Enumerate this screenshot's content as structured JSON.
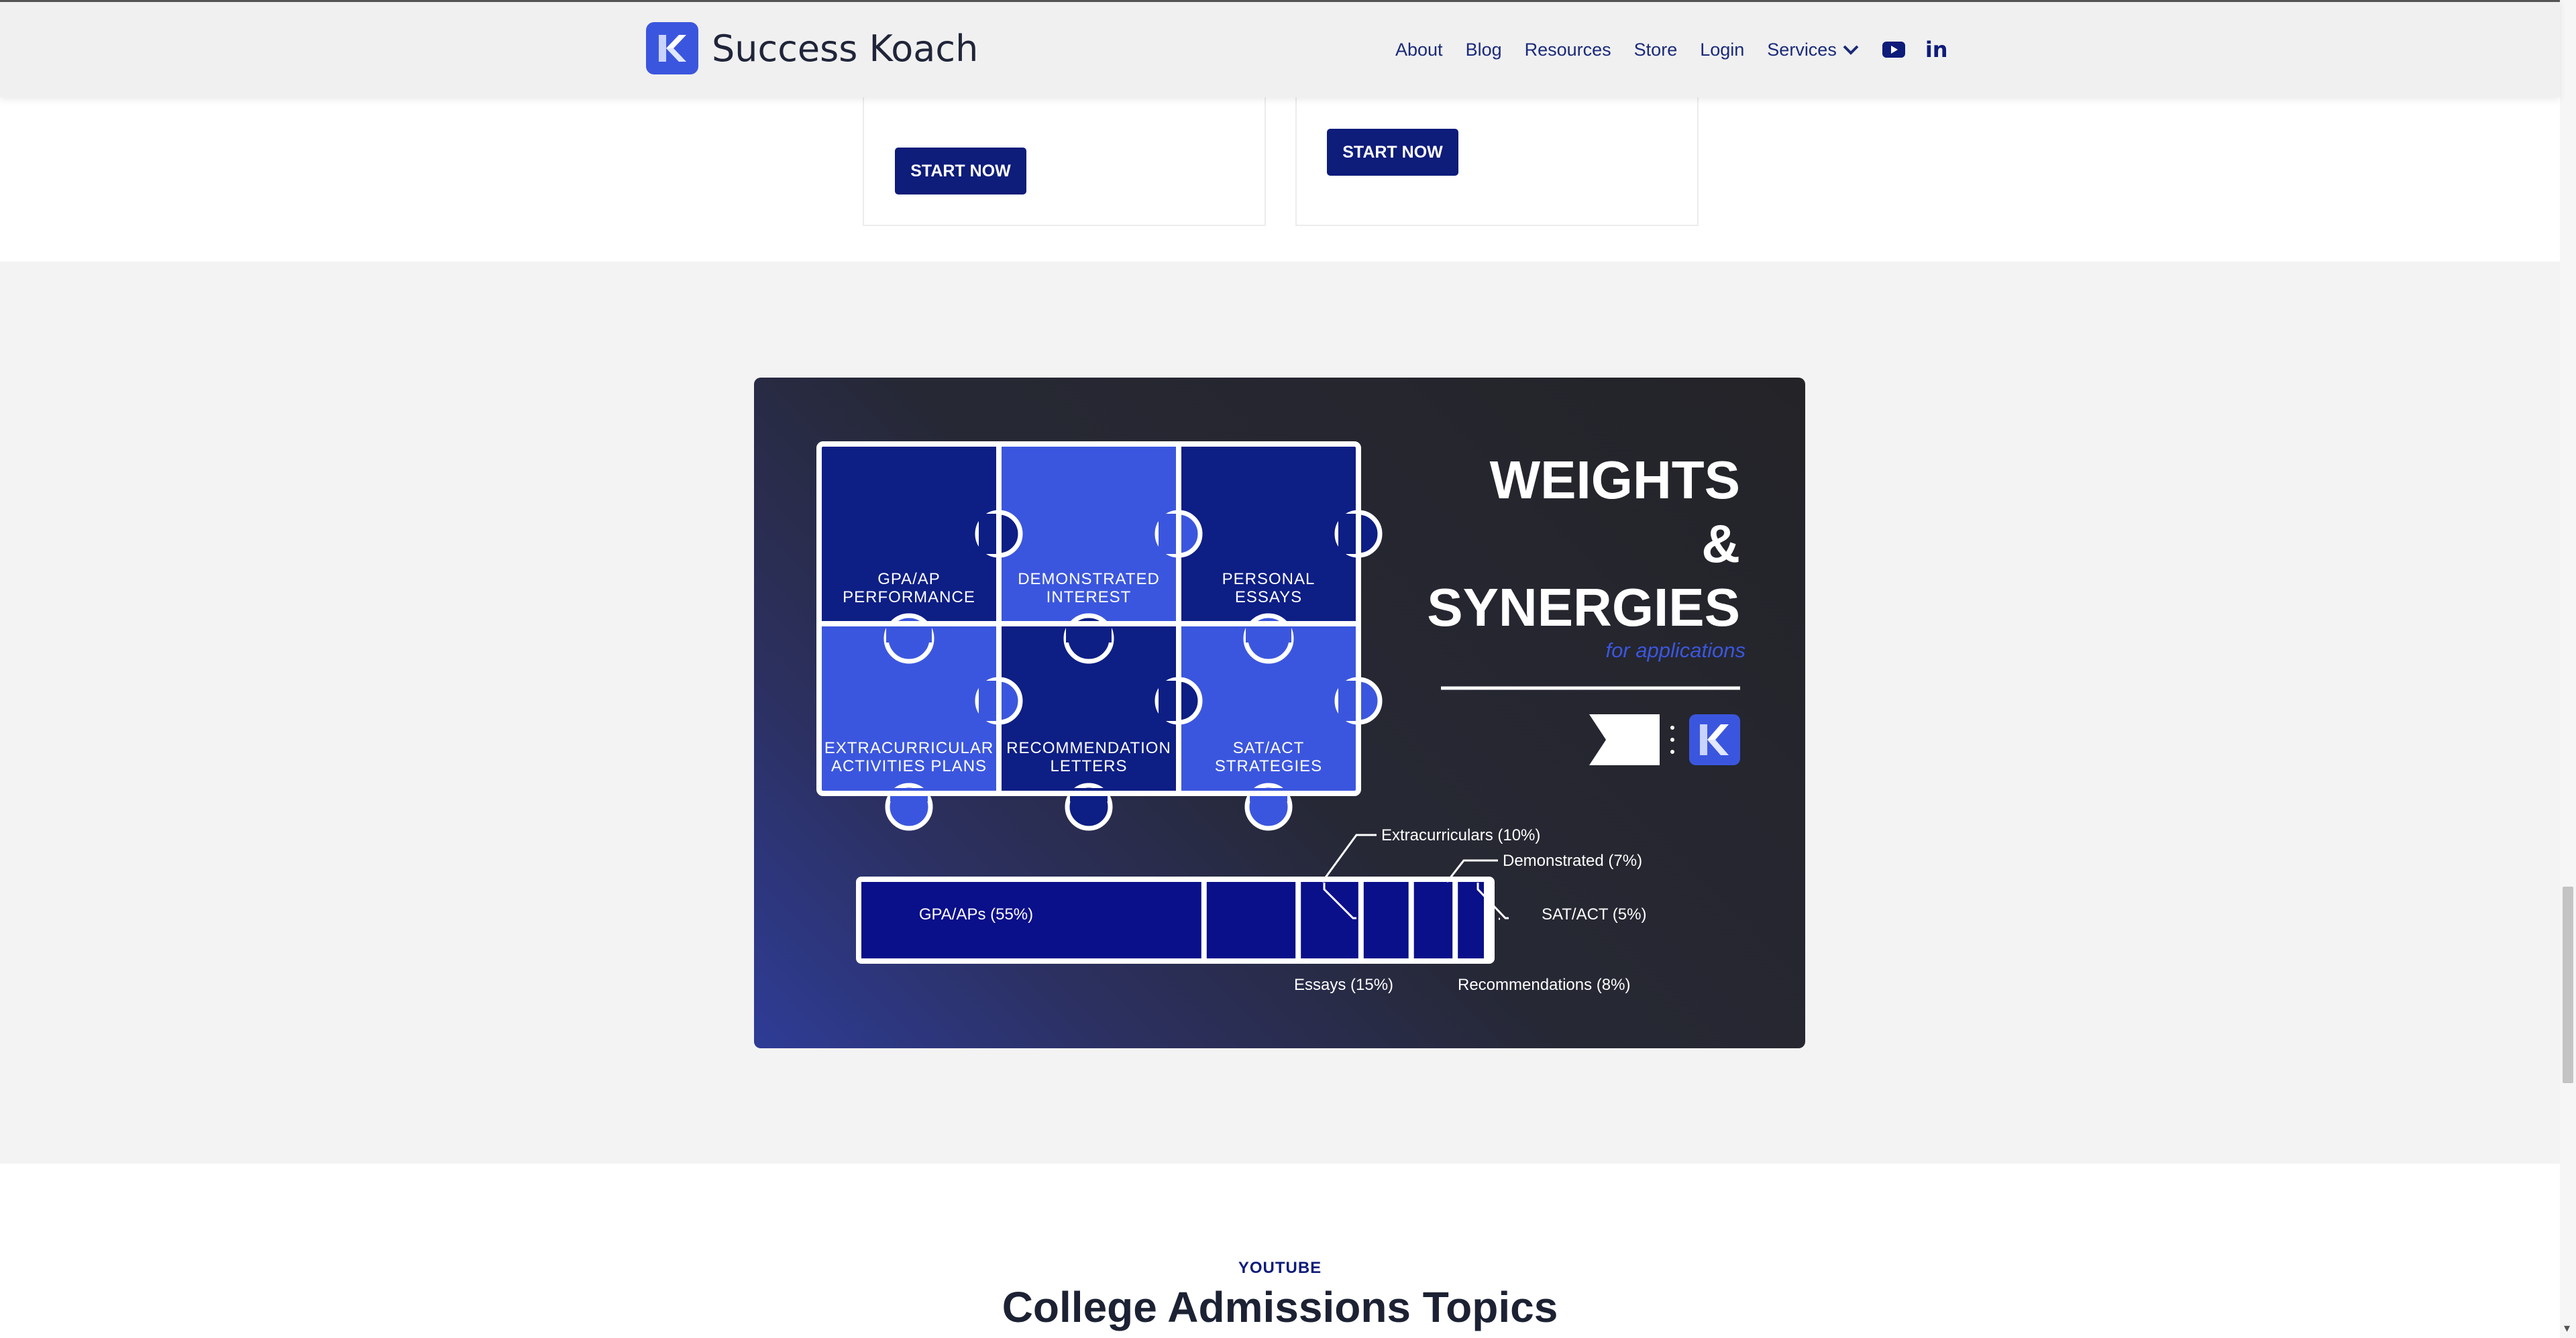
{
  "brand": {
    "name": "Success Koach",
    "logo_icon": "k-logo-icon",
    "color": "#3b56de"
  },
  "nav": {
    "items": [
      "About",
      "Blog",
      "Resources",
      "Store",
      "Login"
    ],
    "services_label": "Services",
    "youtube_icon": "youtube-icon",
    "linkedin_label": "in"
  },
  "cards": [
    {
      "button_label": "START NOW"
    },
    {
      "button_label": "START NOW"
    }
  ],
  "infographic": {
    "title_line1": "WEIGHTS",
    "title_line2": "&",
    "title_line3": "SYNERGIES",
    "subtitle": "for applications",
    "puzzle_pieces": [
      {
        "line1": "GPA/AP",
        "line2": "PERFORMANCE"
      },
      {
        "line1": "DEMONSTRATED",
        "line2": "INTEREST"
      },
      {
        "line1": "PERSONAL",
        "line2": "ESSAYS"
      },
      {
        "line1": "EXTRACURRICULAR",
        "line2": "ACTIVITIES PLANS"
      },
      {
        "line1": "RECOMMENDATION",
        "line2": "LETTERS"
      },
      {
        "line1": "SAT/ACT",
        "line2": "STRATEGIES"
      }
    ],
    "colors": {
      "dark_navy": "#0d1e85",
      "bright_blue": "#3b56de",
      "bar_fill": "#0a0f8a",
      "subtitle": "#3b56de"
    }
  },
  "chart_data": {
    "type": "bar",
    "categories": [
      "GPA/APs",
      "Essays",
      "Extracurriculars",
      "Recommendations",
      "Demonstrated",
      "SAT/ACT"
    ],
    "values": [
      55,
      15,
      10,
      8,
      7,
      5
    ],
    "unit": "%",
    "label_texts": [
      "GPA/APs (55%)",
      "Essays (15%)",
      "Extracurriculars (10%)",
      "Recommendations (8%)",
      "Demonstrated (7%)",
      "SAT/ACT (5%)"
    ]
  },
  "youtube_section": {
    "eyebrow": "YOUTUBE",
    "title": "College Admissions Topics"
  }
}
